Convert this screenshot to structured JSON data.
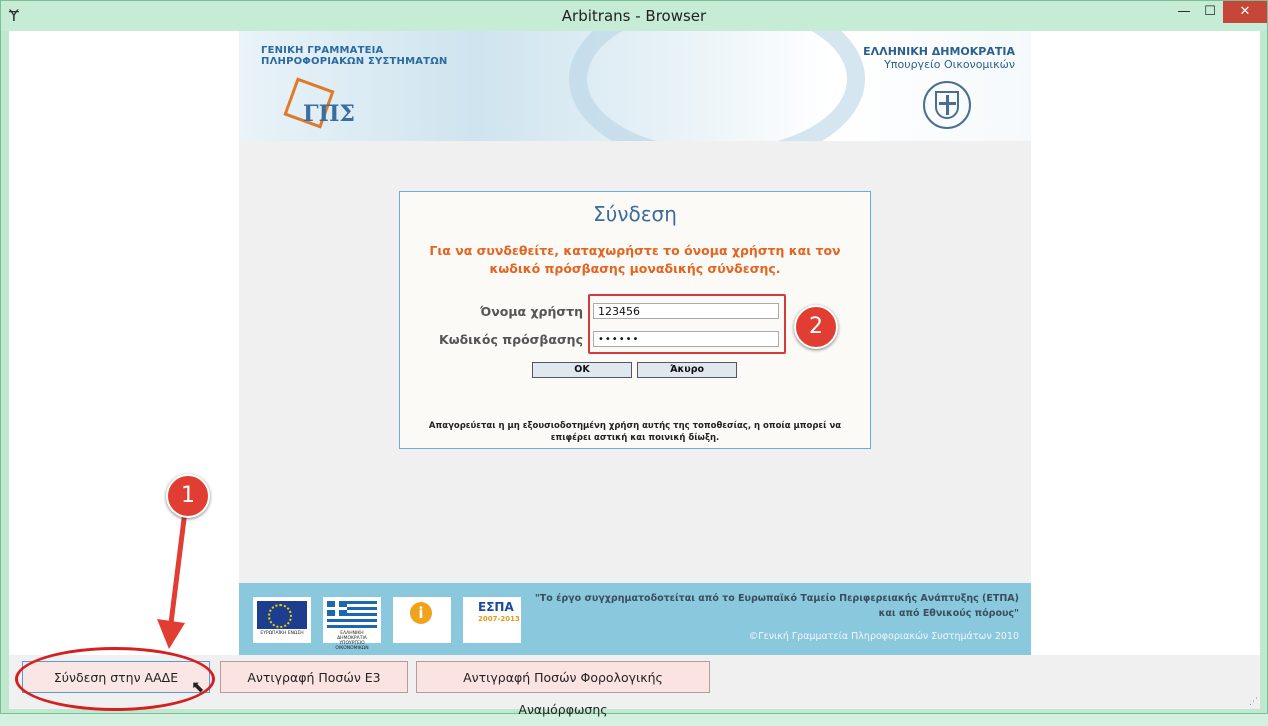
{
  "window": {
    "title": "Arbitrans - Browser",
    "app_icon": "Ɏ",
    "min_symbol": "—",
    "max_symbol": "☐",
    "close_symbol": "✕"
  },
  "banner": {
    "left_line1": "ΓΕΝΙΚΗ ΓΡΑΜΜΑΤΕΙΑ",
    "left_line2": "ΠΛΗΡΟΦΟΡΙΑΚΩΝ ΣΥΣΤΗΜΑΤΩΝ",
    "logo_text": "ΓΠΣ",
    "right_line1": "ΕΛΛΗΝΙΚΗ ΔΗΜΟΚΡΑΤΙΑ",
    "right_line2": "Υπουργείο Οικονομικών"
  },
  "login": {
    "title": "Σύνδεση",
    "instructions": "Για να συνδεθείτε, καταχωρήστε το όνομα χρήστη και τον κωδικό πρόσβασης μοναδικής σύνδεσης.",
    "username_label": "Όνομα χρήστη",
    "username_value": "123456",
    "password_label": "Κωδικός πρόσβασης",
    "password_value": "••••••",
    "ok_label": "OK",
    "cancel_label": "Άκυρο",
    "warning": "Απαγορεύεται η μη εξουσιοδοτημένη χρήση αυτής της τοποθεσίας, η οποία μπορεί να επιφέρει αστική και ποινική δίωξη."
  },
  "annotations": {
    "badge_1": "1",
    "badge_2": "2",
    "color": "#e23d32"
  },
  "footer": {
    "eu_caption": "ΕΥΡΩΠΑΪΚΗ ΕΝΩΣΗ",
    "gr_caption": "ΕΛΛΗΝΙΚΗ ΔΗΜΟΚΡΑΤΙΑ ΥΠΟΥΡΓΕΙΟ ΟΙΚΟΝΟΜΙΚΩΝ",
    "info_symbol": "i",
    "espa_text": "ΕΣΠΑ",
    "espa_sub": "2007-2013",
    "quote_line1": "\"Το έργο συγχρηματοδοτείται από το Ευρωπαϊκό Ταμείο Περιφερειακής Ανάπτυξης (ΕΤΠΑ)",
    "quote_line2": "και από Εθνικούς πόρους\"",
    "copyright": "©Γενική Γραμματεία Πληροφοριακών Συστημάτων 2010"
  },
  "toolbar": {
    "connect_label": "Σύνδεση στην ΑΑΔΕ",
    "copy_e3_label": "Αντιγραφή Ποσών Ε3",
    "copy_tax_label": "Αντιγραφή Ποσών Φορολογικής Αναμόρφωσης"
  }
}
